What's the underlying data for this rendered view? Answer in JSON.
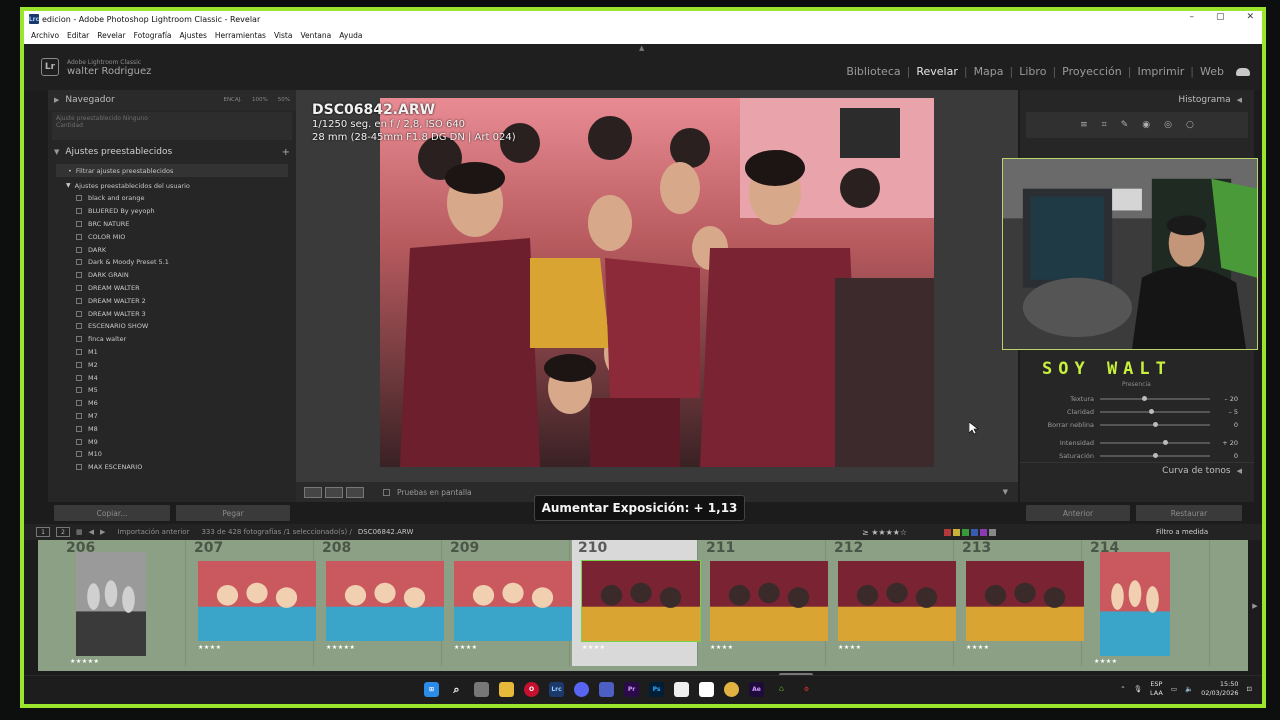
{
  "window": {
    "title": "edicion - Adobe Photoshop Lightroom Classic - Revelar",
    "logo": "Lrc",
    "controls": [
      "–",
      "▢",
      "✕"
    ]
  },
  "menu": [
    "Archivo",
    "Editar",
    "Revelar",
    "Fotografía",
    "Ajustes",
    "Herramientas",
    "Vista",
    "Ventana",
    "Ayuda"
  ],
  "header": {
    "logo_letters": "Lr",
    "product": "Adobe Lightroom Classic",
    "user": "walter Rodriguez",
    "modules": [
      "Biblioteca",
      "Revelar",
      "Mapa",
      "Libro",
      "Proyección",
      "Imprimir",
      "Web"
    ],
    "active_module": "Revelar"
  },
  "left_panel": {
    "navigator": "Navegador",
    "zoom_options": [
      "ENCAJ.",
      "100%",
      "50%"
    ],
    "nav_strip_line1": "Ajuste preestablecido    Ninguno",
    "nav_strip_line2": "Cantidad",
    "presets_title": "Ajustes preestablecidos",
    "presets_add": "+",
    "filter": "Filtrar ajustes preestablecidos",
    "user_group": "Ajustes preestablecidos del usuario",
    "presets": [
      "black and orange",
      "BLUERED By yeyoph",
      "BRC NATURE",
      "COLOR MIO",
      "DARK",
      "Dark & Moody Preset 5.1",
      "DARK GRAIN",
      "DREAM WALTER",
      "DREAM WALTER 2",
      "DREAM WALTER 3",
      "ESCENARIO SHOW",
      "finca walter",
      "M1",
      "M2",
      "M4",
      "M5",
      "M6",
      "M7",
      "M8",
      "M9",
      "M10",
      "MAX ESCENARIO"
    ],
    "copy_button": "Copiar...",
    "paste_button": "Pegar"
  },
  "photo_info": {
    "filename": "DSC06842.ARW",
    "exposure": "1/1250 seg. en f / 2,8, ISO 640",
    "lens": "28 mm (28-45mm F1.8 DG DN | Art 024)"
  },
  "toolbar": {
    "proof_label": "Pruebas en pantalla"
  },
  "right_panel": {
    "histogram": "Histograma",
    "tool_icons": [
      "≡",
      "⌗",
      "✎",
      "◉",
      "◎",
      "○"
    ],
    "overlay_text": "SOY WALT",
    "presence": "Presencia",
    "sliders": [
      {
        "label": "Textura",
        "value": "– 20",
        "pos": 0.4
      },
      {
        "label": "Claridad",
        "value": "– 5",
        "pos": 0.47
      },
      {
        "label": "Borrar neblina",
        "value": "0",
        "pos": 0.5
      },
      {
        "label": "Intensidad",
        "value": "+ 20",
        "pos": 0.6
      },
      {
        "label": "Saturación",
        "value": "0",
        "pos": 0.5
      }
    ],
    "tone_curve": "Curva de tonos",
    "previous_button": "Anterior",
    "reset_button": "Restaurar"
  },
  "toast": "Aumentar Exposición: + 1,13",
  "filmstrip_bar": {
    "pages": [
      "1",
      "2"
    ],
    "source": "Importación anterior",
    "count": "333 de 428 fotografías /1 seleccionado(s) /",
    "current": "DSC06842.ARW",
    "filter_label": "Filtro a medida",
    "stars": "≥ ★★★★☆"
  },
  "filmstrip": [
    {
      "num": "206",
      "stars": "★★★★★",
      "tone": "bw",
      "portrait": true
    },
    {
      "num": "207",
      "stars": "★★★★",
      "tone": "color"
    },
    {
      "num": "208",
      "stars": "★★★★★",
      "tone": "color"
    },
    {
      "num": "209",
      "stars": "★★★★",
      "tone": "color"
    },
    {
      "num": "210",
      "stars": "★★★★",
      "tone": "maroon",
      "selected": true
    },
    {
      "num": "211",
      "stars": "★★★★",
      "tone": "maroon"
    },
    {
      "num": "212",
      "stars": "★★★★",
      "tone": "maroon"
    },
    {
      "num": "213",
      "stars": "★★★★",
      "tone": "maroon"
    },
    {
      "num": "214",
      "stars": "★★★★",
      "tone": "color",
      "portrait": true
    }
  ],
  "taskbar": {
    "language": "ESP",
    "layout": "LAA",
    "time": "15:50",
    "date": "02/03/2026"
  },
  "colors": {
    "accent_green": "#9be52c",
    "filmstrip_bg": "#8ca085",
    "soywalt": "#c8f03c"
  }
}
